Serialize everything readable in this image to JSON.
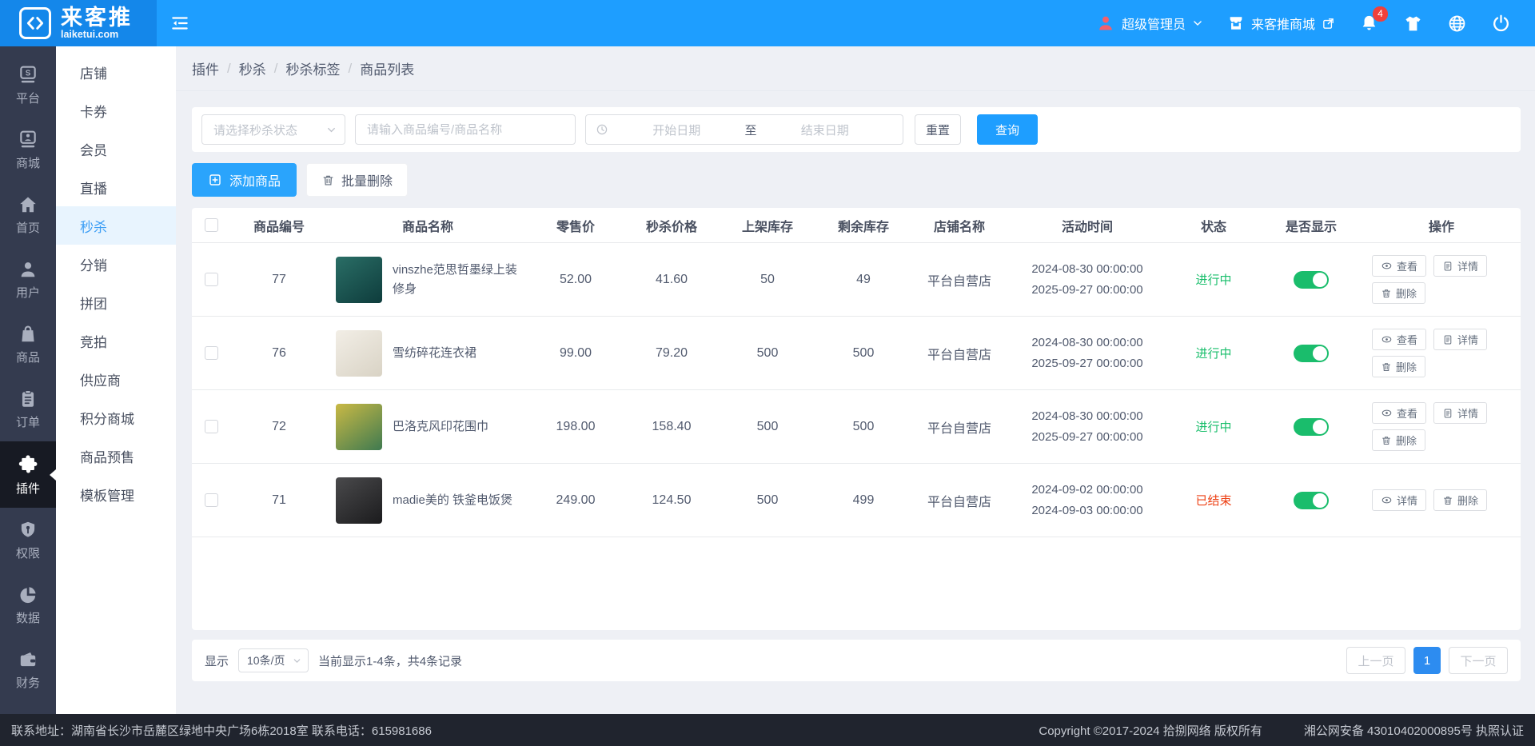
{
  "topbar": {
    "logo_title": "来客推",
    "logo_domain": "laiketui.com",
    "user_name": "超级管理员",
    "shop_name": "来客推商城",
    "notification_count": "4"
  },
  "sidebar": {
    "items": [
      {
        "label": "平台",
        "icon": "platform"
      },
      {
        "label": "商城",
        "icon": "mall"
      },
      {
        "label": "首页",
        "icon": "home"
      },
      {
        "label": "用户",
        "icon": "user"
      },
      {
        "label": "商品",
        "icon": "goods"
      },
      {
        "label": "订单",
        "icon": "order"
      },
      {
        "label": "插件",
        "icon": "plugin",
        "active": true
      },
      {
        "label": "权限",
        "icon": "permission"
      },
      {
        "label": "数据",
        "icon": "data"
      },
      {
        "label": "财务",
        "icon": "finance"
      },
      {
        "label": "",
        "icon": "media"
      }
    ]
  },
  "submenu": {
    "items": [
      "店铺",
      "卡券",
      "会员",
      "直播",
      "秒杀",
      "分销",
      "拼团",
      "竞拍",
      "供应商",
      "积分商城",
      "商品预售",
      "模板管理"
    ],
    "active": "秒杀"
  },
  "breadcrumb": [
    "插件",
    "秒杀",
    "秒杀标签",
    "商品列表"
  ],
  "filters": {
    "status_placeholder": "请选择秒杀状态",
    "search_placeholder": "请输入商品编号/商品名称",
    "date_start_placeholder": "开始日期",
    "date_separator": "至",
    "date_end_placeholder": "结束日期",
    "reset_label": "重置",
    "search_label": "查询"
  },
  "actions": {
    "add_label": "添加商品",
    "batch_delete_label": "批量删除"
  },
  "table": {
    "headers": [
      "商品编号",
      "商品名称",
      "零售价",
      "秒杀价格",
      "上架库存",
      "剩余库存",
      "店铺名称",
      "活动时间",
      "状态",
      "是否显示",
      "操作"
    ],
    "rows": [
      {
        "id": "77",
        "name": "vinszhe范思哲墨绿上装修身",
        "retail": "52.00",
        "seckill": "41.60",
        "stock": "50",
        "remaining": "49",
        "shop": "平台自营店",
        "time_start": "2024-08-30 00:00:00",
        "time_end": "2025-09-27 00:00:00",
        "status": "进行中",
        "status_state": "ongoing",
        "visible": true,
        "img_colors": [
          "#2a6e66",
          "#0e3c3c"
        ],
        "ops": [
          [
            {
              "icon": "eye",
              "label": "查看"
            },
            {
              "icon": "doc",
              "label": "详情"
            }
          ],
          [
            {
              "icon": "trash",
              "label": "删除"
            }
          ]
        ]
      },
      {
        "id": "76",
        "name": "雪纺碎花连衣裙",
        "retail": "99.00",
        "seckill": "79.20",
        "stock": "500",
        "remaining": "500",
        "shop": "平台自营店",
        "time_start": "2024-08-30 00:00:00",
        "time_end": "2025-09-27 00:00:00",
        "status": "进行中",
        "status_state": "ongoing",
        "visible": true,
        "img_colors": [
          "#f2eee6",
          "#d9d3c5"
        ],
        "ops": [
          [
            {
              "icon": "eye",
              "label": "查看"
            },
            {
              "icon": "doc",
              "label": "详情"
            }
          ],
          [
            {
              "icon": "trash",
              "label": "删除"
            }
          ]
        ]
      },
      {
        "id": "72",
        "name": "巴洛克风印花围巾",
        "retail": "198.00",
        "seckill": "158.40",
        "stock": "500",
        "remaining": "500",
        "shop": "平台自营店",
        "time_start": "2024-08-30 00:00:00",
        "time_end": "2025-09-27 00:00:00",
        "status": "进行中",
        "status_state": "ongoing",
        "visible": true,
        "img_colors": [
          "#c9b945",
          "#3f7a50"
        ],
        "ops": [
          [
            {
              "icon": "eye",
              "label": "查看"
            },
            {
              "icon": "doc",
              "label": "详情"
            }
          ],
          [
            {
              "icon": "trash",
              "label": "删除"
            }
          ]
        ]
      },
      {
        "id": "71",
        "name": "madie美的 铁釜电饭煲",
        "retail": "249.00",
        "seckill": "124.50",
        "stock": "500",
        "remaining": "499",
        "shop": "平台自营店",
        "time_start": "2024-09-02 00:00:00",
        "time_end": "2024-09-03 00:00:00",
        "status": "已结束",
        "status_state": "ended",
        "visible": true,
        "img_colors": [
          "#4a4a4c",
          "#1b1b1d"
        ],
        "ops": [
          [
            {
              "icon": "eye",
              "label": "详情"
            },
            {
              "icon": "trash",
              "label": "删除"
            }
          ]
        ]
      }
    ]
  },
  "pagination": {
    "show_label": "显示",
    "page_size": "10条/页",
    "summary": "当前显示1-4条，共4条记录",
    "prev_label": "上一页",
    "current_page": "1",
    "next_label": "下一页"
  },
  "footer": {
    "contact": "联系地址：湖南省长沙市岳麓区绿地中央广场6栋2018室 联系电话：615981686",
    "copyright": "Copyright ©2017-2024 拾捌网络 版权所有",
    "police": "湘公网安备 43010402000895号 执照认证"
  },
  "colors": {
    "accent": "#1e9eff",
    "status_ongoing": "#19be6b",
    "status_ended": "#ed4014",
    "toggle_on": "#1abd6c"
  }
}
